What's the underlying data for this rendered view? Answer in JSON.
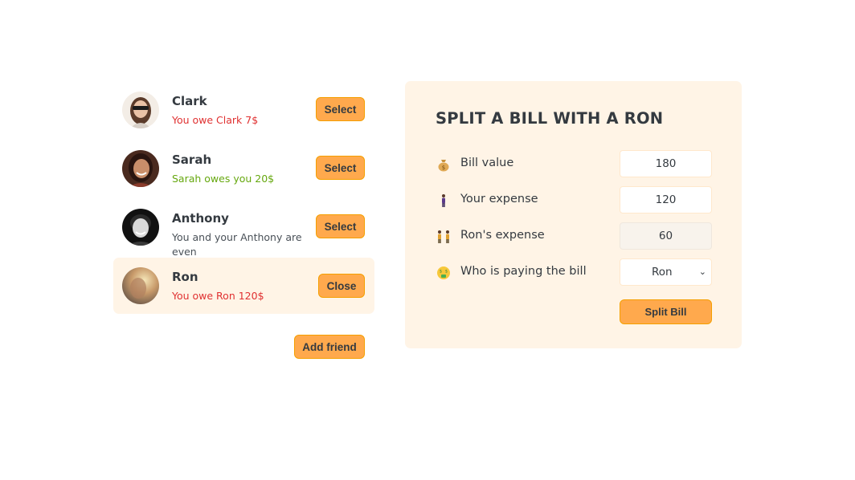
{
  "friends": [
    {
      "name": "Clark",
      "status": "You owe Clark 7$",
      "status_type": "owe",
      "button": "Select",
      "selected": false,
      "avatar": "woman-sunglasses-avatar"
    },
    {
      "name": "Sarah",
      "status": "Sarah owes you 20$",
      "status_type": "owed",
      "button": "Select",
      "selected": false,
      "avatar": "woman-smiling-avatar"
    },
    {
      "name": "Anthony",
      "status": "You and your Anthony are even",
      "status_type": "even",
      "button": "Select",
      "selected": false,
      "avatar": "man-bw-avatar"
    },
    {
      "name": "Ron",
      "status": "You owe Ron 120$",
      "status_type": "owe",
      "button": "Close",
      "selected": true,
      "avatar": "man-blurry-avatar"
    }
  ],
  "add_friend_label": "Add friend",
  "split_form": {
    "title": "SPLIT A BILL WITH A RON",
    "bill_label": "Bill value",
    "bill_value": "180",
    "bill_icon": "money-bag-icon",
    "expense_label": "Your expense",
    "expense_value": "120",
    "expense_icon": "person-icon",
    "friend_expense_label": "Ron's expense",
    "friend_expense_value": "60",
    "friend_expense_icon": "two-people-icon",
    "payer_label": "Who is paying the bill",
    "payer_value": "Ron",
    "payer_icon": "money-mouth-face-icon",
    "submit_label": "Split Bill"
  },
  "colors": {
    "accent": "#ffa94d",
    "panel_bg": "#fff4e6",
    "owe_red": "#e03131",
    "owed_green": "#66a80f"
  }
}
